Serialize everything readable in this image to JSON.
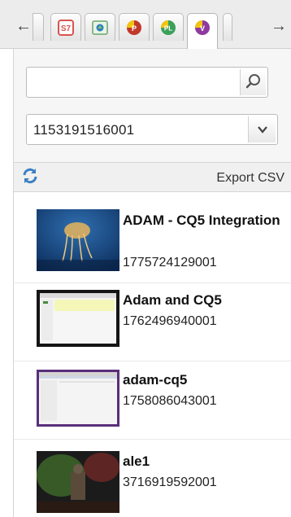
{
  "tabs": [
    {
      "name": "s7",
      "label": "S7"
    },
    {
      "name": "image",
      "label": ""
    },
    {
      "name": "product",
      "label": "P"
    },
    {
      "name": "pl",
      "label": "PL"
    },
    {
      "name": "video",
      "label": "V"
    }
  ],
  "search": {
    "value": "",
    "placeholder": ""
  },
  "account_select": {
    "selected": "1153191516001"
  },
  "toolbar": {
    "export_label": "Export CSV"
  },
  "videos": [
    {
      "title": "ADAM - CQ5 Integration",
      "id": "1775724129001",
      "thumb": "jellyfish"
    },
    {
      "title": "Adam and CQ5",
      "id": "1762496940001",
      "thumb": "screen-yellow"
    },
    {
      "title": "adam-cq5",
      "id": "1758086043001",
      "thumb": "screen-purple"
    },
    {
      "title": "ale1",
      "id": "3716919592001",
      "thumb": "concert"
    }
  ],
  "colors": {
    "accent_blue": "#3a7fc4",
    "panel_bg": "#f6f6f6"
  }
}
